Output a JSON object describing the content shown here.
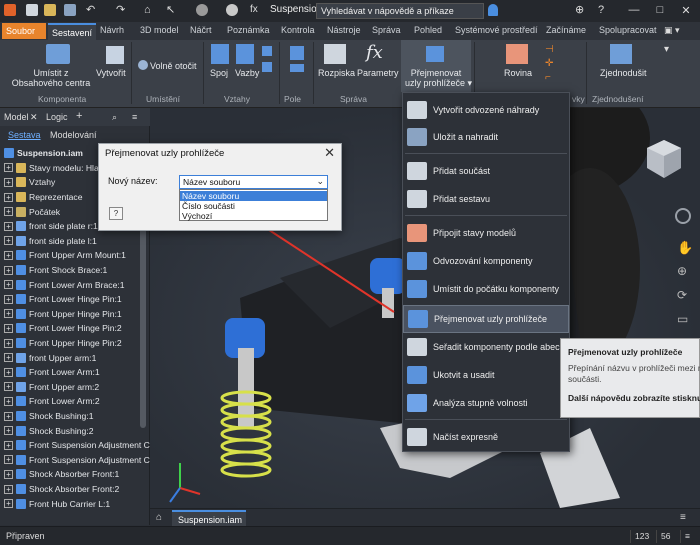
{
  "window": {
    "title": "Suspension.i...",
    "help_search_placeholder": "Vyhledávat v nápovědě a příkaze",
    "minimize": "—",
    "maximize": "□",
    "close": "✕"
  },
  "ribbon": {
    "tabs": [
      "Soubor",
      "Sestavení",
      "Návrh",
      "3D model",
      "Náčrt",
      "Poznámka",
      "Kontrola",
      "Nástroje",
      "Správa",
      "Pohled",
      "Systémové prostředí",
      "Začínáme",
      "Spolupracovat"
    ],
    "active_tab": "Sestavení",
    "buttons": {
      "place": "Umístit z\nObsahového centra",
      "create": "Vytvořit",
      "free_orbit": "Volně otočit",
      "join": "Spoj",
      "constraints": "Vazby",
      "pattern": "Rozpiska",
      "parameters": "Parametry",
      "rename_nodes": "Přejmenovat\nuzly prohlížeče",
      "plane": "Rovina",
      "simplify": "Zjednodušit"
    },
    "groups": {
      "component": "Komponenta",
      "position": "Umístění",
      "relationships": "Vztahy",
      "pattern": "Pole",
      "manage": "Správa",
      "simplification": "Zjednodušení",
      "work_features": "vky"
    }
  },
  "browser": {
    "tab_model": "Model",
    "tab_logic": "Logic",
    "sub_assembly": "Sestava",
    "sub_modeling": "Modelování",
    "items": [
      {
        "label": "Suspension.iam",
        "icon": "assembly",
        "plus": false,
        "bold": true
      },
      {
        "label": "Stavy modelu: Hlav",
        "icon": "folder",
        "plus": true
      },
      {
        "label": "Vztahy",
        "icon": "folder",
        "plus": true
      },
      {
        "label": "Reprezentace",
        "icon": "folder",
        "plus": true
      },
      {
        "label": "Počátek",
        "icon": "origin",
        "plus": true
      },
      {
        "label": "front side plate r:1",
        "icon": "link",
        "plus": true
      },
      {
        "label": "front side plate l:1",
        "icon": "link",
        "plus": true
      },
      {
        "label": "Front Upper Arm Mount:1",
        "icon": "part",
        "plus": true
      },
      {
        "label": "Front Shock Brace:1",
        "icon": "part",
        "plus": true
      },
      {
        "label": "Front Lower Arm Brace:1",
        "icon": "part",
        "plus": true
      },
      {
        "label": "Front Lower Hinge Pin:1",
        "icon": "part",
        "plus": true
      },
      {
        "label": "Front Upper Hinge Pin:1",
        "icon": "part",
        "plus": true
      },
      {
        "label": "Front Lower Hinge Pin:2",
        "icon": "part",
        "plus": true
      },
      {
        "label": "Front Upper Hinge Pin:2",
        "icon": "part",
        "plus": true
      },
      {
        "label": "front Upper arm:1",
        "icon": "link",
        "plus": true
      },
      {
        "label": "Front Lower Arm:1",
        "icon": "part",
        "plus": true
      },
      {
        "label": "Front Upper arm:2",
        "icon": "link",
        "plus": true
      },
      {
        "label": "Front Lower Arm:2",
        "icon": "part",
        "plus": true
      },
      {
        "label": "Shock Bushing:1",
        "icon": "part",
        "plus": true
      },
      {
        "label": "Shock Bushing:2",
        "icon": "part",
        "plus": true
      },
      {
        "label": "Front Suspension Adjustment C",
        "icon": "part",
        "plus": true
      },
      {
        "label": "Front Suspension Adjustment C",
        "icon": "part",
        "plus": true
      },
      {
        "label": "Shock Absorber Front:1",
        "icon": "part",
        "plus": true
      },
      {
        "label": "Shock Absorber Front:2",
        "icon": "part",
        "plus": true
      },
      {
        "label": "Front Hub Carrier L:1",
        "icon": "part",
        "plus": true
      }
    ]
  },
  "dialog": {
    "title": "Přejmenovat uzly prohlížeče",
    "label": "Nový název:",
    "selected": "Název souboru",
    "options": [
      "Název souboru",
      "Číslo součásti",
      "Výchozí"
    ],
    "help": "?"
  },
  "menu": {
    "items": [
      {
        "label": "Vytvořit odvozené náhrady",
        "icon": "derived-substitute-icon"
      },
      {
        "label": "Uložit a nahradit",
        "icon": "save-replace-icon"
      },
      {
        "label": "Přidat součást",
        "icon": "add-part-icon"
      },
      {
        "label": "Přidat sestavu",
        "icon": "add-assembly-icon"
      },
      {
        "label": "Připojit stavy modelů",
        "icon": "link-model-states-icon"
      },
      {
        "label": "Odvozování komponenty",
        "icon": "derive-component-icon"
      },
      {
        "label": "Umístit do počátku komponenty",
        "icon": "ground-origin-icon"
      },
      {
        "label": "Přejmenovat uzly prohlížeče",
        "icon": "rename-nodes-icon"
      },
      {
        "label": "Seřadit komponenty podle abeced",
        "icon": "sort-alpha-icon"
      },
      {
        "label": "Ukotvit a usadit",
        "icon": "ground-root-icon"
      },
      {
        "label": "Analýza stupně volnosti",
        "icon": "dof-analysis-icon"
      },
      {
        "label": "Načíst expresně",
        "icon": "load-express-icon"
      }
    ],
    "highlighted": "Přejmenovat uzly prohlížeče"
  },
  "tooltip": {
    "title": "Přejmenovat uzly prohlížeče",
    "desc1": "Přepínání názvu v prohlížeči mezi n",
    "desc2": "součásti.",
    "more": "Další nápovědu zobrazíte stisknu"
  },
  "document_tab": "Suspension.iam",
  "status": {
    "text": "Připraven",
    "count1": "123",
    "count2": "56"
  },
  "colors": {
    "accent": "#4a8ee0",
    "file_tab": "#e8842c",
    "arrow": "#e0342a",
    "spring": "#d7e04a",
    "shock_blue": "#2e6fd6"
  }
}
